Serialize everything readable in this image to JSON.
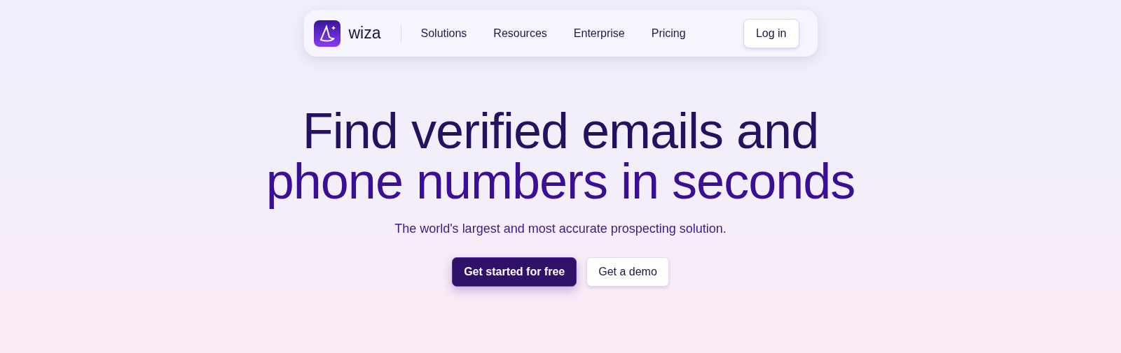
{
  "nav": {
    "brand": "wiza",
    "links": [
      "Solutions",
      "Resources",
      "Enterprise",
      "Pricing"
    ],
    "login": "Log in"
  },
  "hero": {
    "headline_lines": [
      "Find verified emails and",
      "phone numbers in seconds"
    ],
    "subtitle": "The world's largest and most accurate prospecting solution.",
    "buttons": [
      {
        "label": "Get started for free",
        "kind": "primary"
      },
      {
        "label": "Get a demo",
        "kind": "secondary"
      }
    ]
  }
}
